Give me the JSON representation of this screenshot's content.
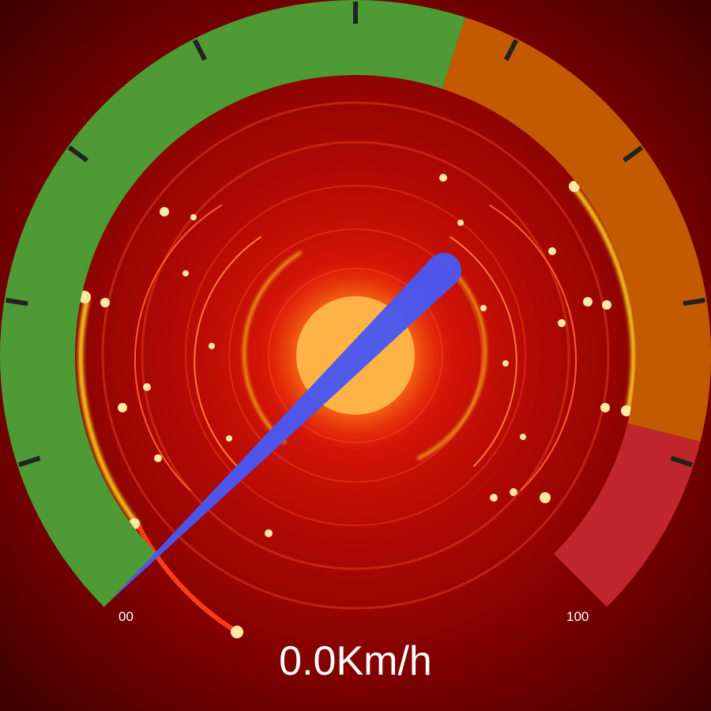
{
  "speedometer": {
    "min_label": "00",
    "max_label": "100",
    "readout": "0.0Km/h",
    "needle_value": 58,
    "zones": [
      {
        "name": "safe",
        "color": "#4e9a35"
      },
      {
        "name": "warning",
        "color": "#c45a00"
      },
      {
        "name": "danger",
        "color": "#c0262b"
      }
    ],
    "needle_color": "#4a58f0",
    "hub_color": "#ffb347",
    "tick_color": "#222222"
  }
}
